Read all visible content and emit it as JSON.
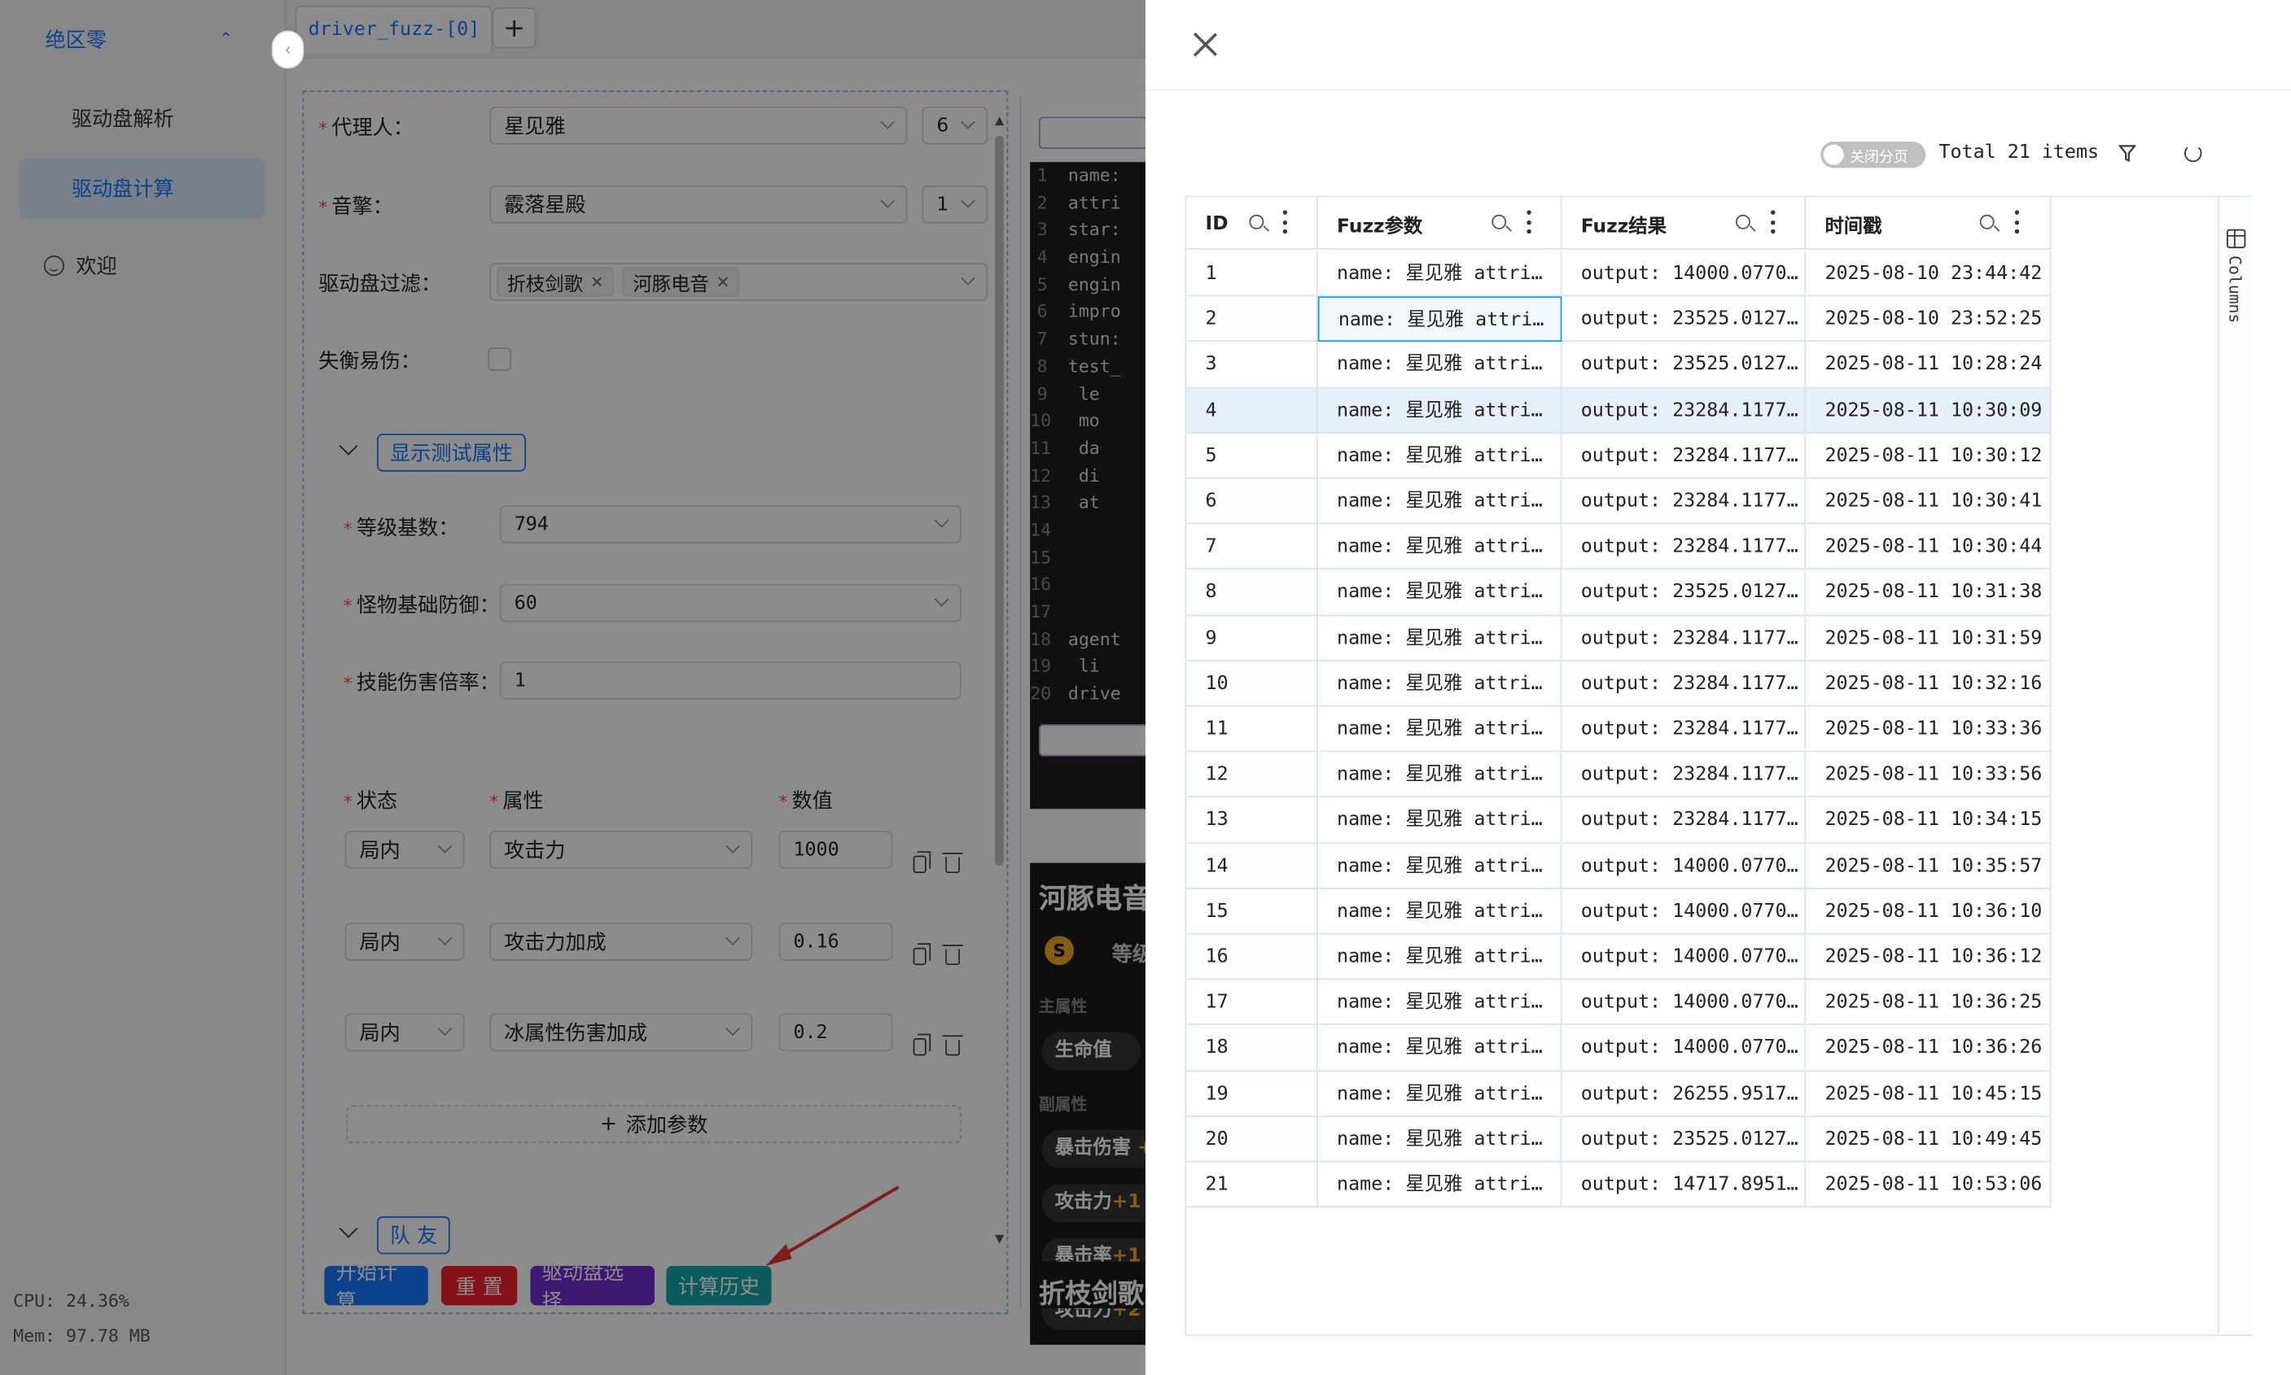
{
  "sidebar": {
    "group": "绝区零",
    "items": [
      {
        "label": "驱动盘解析"
      },
      {
        "label": "驱动盘计算"
      }
    ],
    "welcome": "欢迎",
    "cpu": "CPU: 24.36%",
    "mem": "Mem: 97.78 MB"
  },
  "tabs": {
    "active": "driver_fuzz-[0]",
    "add": "+"
  },
  "form": {
    "agent_label": "代理人：",
    "agent_value": "星见雅",
    "agent_level": "6",
    "engine_label": "音擎：",
    "engine_value": "霰落星殿",
    "engine_level": "1",
    "filter_label": "驱动盘过滤：",
    "filter_tags": [
      "折枝剑歌",
      "河豚电音"
    ],
    "stun_label": "失衡易伤：",
    "show_test_attrs": "显示测试属性",
    "level_base_label": "等级基数：",
    "level_base_value": "794",
    "monster_def_label": "怪物基础防御：",
    "monster_def_value": "60",
    "skill_mult_label": "技能伤害倍率：",
    "skill_mult_value": "1",
    "col_state": "状态",
    "col_attr": "属性",
    "col_value": "数值",
    "params": [
      {
        "state": "局内",
        "attr": "攻击力",
        "value": "1000"
      },
      {
        "state": "局内",
        "attr": "攻击力加成",
        "value": "0.16"
      },
      {
        "state": "局内",
        "attr": "冰属性伤害加成",
        "value": "0.2"
      }
    ],
    "add_param": "添加参数",
    "teammates": "队 友",
    "buttons": {
      "start": "开始计算",
      "reset": "重 置",
      "disk_select": "驱动盘选择",
      "history": "计算历史"
    },
    "colors": {
      "start": "#1677ff",
      "reset": "#f5222d",
      "disk_select": "#722ed1",
      "history": "#13a8a8"
    }
  },
  "code": {
    "lines": [
      "name:",
      "attri",
      "star:",
      "engin",
      "engin",
      "impro",
      "stun:",
      "test_",
      "   le",
      "   mo",
      "   da",
      "   di",
      "   at",
      "",
      "",
      "",
      "",
      "agent",
      "   li",
      "drive"
    ]
  },
  "game_image": {
    "title": "河豚电音",
    "level": "等级",
    "main_attr": "主属性",
    "hp": "生命值",
    "sub_attr": "副属性",
    "crit_dmg": "暴击伤害",
    "atk1": "攻击力",
    "atk1_suffix": "+1",
    "crit_rate": "暴击率",
    "crit_suffix": "+1",
    "atk2": "攻击力",
    "atk2_suffix": "+2",
    "bottom": "折枝剑歌"
  },
  "drawer": {
    "switch_label": "关闭分页",
    "total": "Total 21 items",
    "columns_label": "Columns",
    "headers": [
      "ID",
      "Fuzz参数",
      "Fuzz结果",
      "时间戳"
    ],
    "rows": [
      {
        "id": "1",
        "param": "name: 星见雅 attri…",
        "result": "output: 14000.0770…",
        "time": "2025-08-10 23:44:42"
      },
      {
        "id": "2",
        "param": "name: 星见雅 attri…",
        "result": "output: 23525.0127…",
        "time": "2025-08-10 23:52:25"
      },
      {
        "id": "3",
        "param": "name: 星见雅 attri…",
        "result": "output: 23525.0127…",
        "time": "2025-08-11 10:28:24"
      },
      {
        "id": "4",
        "param": "name: 星见雅 attri…",
        "result": "output: 23284.1177…",
        "time": "2025-08-11 10:30:09"
      },
      {
        "id": "5",
        "param": "name: 星见雅 attri…",
        "result": "output: 23284.1177…",
        "time": "2025-08-11 10:30:12"
      },
      {
        "id": "6",
        "param": "name: 星见雅 attri…",
        "result": "output: 23284.1177…",
        "time": "2025-08-11 10:30:41"
      },
      {
        "id": "7",
        "param": "name: 星见雅 attri…",
        "result": "output: 23284.1177…",
        "time": "2025-08-11 10:30:44"
      },
      {
        "id": "8",
        "param": "name: 星见雅 attri…",
        "result": "output: 23525.0127…",
        "time": "2025-08-11 10:31:38"
      },
      {
        "id": "9",
        "param": "name: 星见雅 attri…",
        "result": "output: 23284.1177…",
        "time": "2025-08-11 10:31:59"
      },
      {
        "id": "10",
        "param": "name: 星见雅 attri…",
        "result": "output: 23284.1177…",
        "time": "2025-08-11 10:32:16"
      },
      {
        "id": "11",
        "param": "name: 星见雅 attri…",
        "result": "output: 23284.1177…",
        "time": "2025-08-11 10:33:36"
      },
      {
        "id": "12",
        "param": "name: 星见雅 attri…",
        "result": "output: 23284.1177…",
        "time": "2025-08-11 10:33:56"
      },
      {
        "id": "13",
        "param": "name: 星见雅 attri…",
        "result": "output: 23284.1177…",
        "time": "2025-08-11 10:34:15"
      },
      {
        "id": "14",
        "param": "name: 星见雅 attri…",
        "result": "output: 14000.0770…",
        "time": "2025-08-11 10:35:57"
      },
      {
        "id": "15",
        "param": "name: 星见雅 attri…",
        "result": "output: 14000.0770…",
        "time": "2025-08-11 10:36:10"
      },
      {
        "id": "16",
        "param": "name: 星见雅 attri…",
        "result": "output: 14000.0770…",
        "time": "2025-08-11 10:36:12"
      },
      {
        "id": "17",
        "param": "name: 星见雅 attri…",
        "result": "output: 14000.0770…",
        "time": "2025-08-11 10:36:25"
      },
      {
        "id": "18",
        "param": "name: 星见雅 attri…",
        "result": "output: 14000.0770…",
        "time": "2025-08-11 10:36:26"
      },
      {
        "id": "19",
        "param": "name: 星见雅 attri…",
        "result": "output: 26255.9517…",
        "time": "2025-08-11 10:45:15"
      },
      {
        "id": "20",
        "param": "name: 星见雅 attri…",
        "result": "output: 23525.0127…",
        "time": "2025-08-11 10:49:45"
      },
      {
        "id": "21",
        "param": "name: 星见雅 attri…",
        "result": "output: 14717.8951…",
        "time": "2025-08-11 10:53:06"
      }
    ]
  }
}
